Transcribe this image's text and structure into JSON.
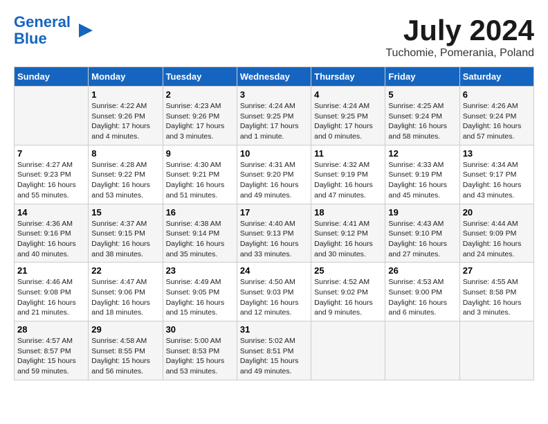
{
  "logo": {
    "line1": "General",
    "line2": "Blue"
  },
  "title": "July 2024",
  "location": "Tuchomie, Pomerania, Poland",
  "days_of_week": [
    "Sunday",
    "Monday",
    "Tuesday",
    "Wednesday",
    "Thursday",
    "Friday",
    "Saturday"
  ],
  "weeks": [
    [
      {
        "day": "",
        "info": ""
      },
      {
        "day": "1",
        "info": "Sunrise: 4:22 AM\nSunset: 9:26 PM\nDaylight: 17 hours\nand 4 minutes."
      },
      {
        "day": "2",
        "info": "Sunrise: 4:23 AM\nSunset: 9:26 PM\nDaylight: 17 hours\nand 3 minutes."
      },
      {
        "day": "3",
        "info": "Sunrise: 4:24 AM\nSunset: 9:25 PM\nDaylight: 17 hours\nand 1 minute."
      },
      {
        "day": "4",
        "info": "Sunrise: 4:24 AM\nSunset: 9:25 PM\nDaylight: 17 hours\nand 0 minutes."
      },
      {
        "day": "5",
        "info": "Sunrise: 4:25 AM\nSunset: 9:24 PM\nDaylight: 16 hours\nand 58 minutes."
      },
      {
        "day": "6",
        "info": "Sunrise: 4:26 AM\nSunset: 9:24 PM\nDaylight: 16 hours\nand 57 minutes."
      }
    ],
    [
      {
        "day": "7",
        "info": "Sunrise: 4:27 AM\nSunset: 9:23 PM\nDaylight: 16 hours\nand 55 minutes."
      },
      {
        "day": "8",
        "info": "Sunrise: 4:28 AM\nSunset: 9:22 PM\nDaylight: 16 hours\nand 53 minutes."
      },
      {
        "day": "9",
        "info": "Sunrise: 4:30 AM\nSunset: 9:21 PM\nDaylight: 16 hours\nand 51 minutes."
      },
      {
        "day": "10",
        "info": "Sunrise: 4:31 AM\nSunset: 9:20 PM\nDaylight: 16 hours\nand 49 minutes."
      },
      {
        "day": "11",
        "info": "Sunrise: 4:32 AM\nSunset: 9:19 PM\nDaylight: 16 hours\nand 47 minutes."
      },
      {
        "day": "12",
        "info": "Sunrise: 4:33 AM\nSunset: 9:19 PM\nDaylight: 16 hours\nand 45 minutes."
      },
      {
        "day": "13",
        "info": "Sunrise: 4:34 AM\nSunset: 9:17 PM\nDaylight: 16 hours\nand 43 minutes."
      }
    ],
    [
      {
        "day": "14",
        "info": "Sunrise: 4:36 AM\nSunset: 9:16 PM\nDaylight: 16 hours\nand 40 minutes."
      },
      {
        "day": "15",
        "info": "Sunrise: 4:37 AM\nSunset: 9:15 PM\nDaylight: 16 hours\nand 38 minutes."
      },
      {
        "day": "16",
        "info": "Sunrise: 4:38 AM\nSunset: 9:14 PM\nDaylight: 16 hours\nand 35 minutes."
      },
      {
        "day": "17",
        "info": "Sunrise: 4:40 AM\nSunset: 9:13 PM\nDaylight: 16 hours\nand 33 minutes."
      },
      {
        "day": "18",
        "info": "Sunrise: 4:41 AM\nSunset: 9:12 PM\nDaylight: 16 hours\nand 30 minutes."
      },
      {
        "day": "19",
        "info": "Sunrise: 4:43 AM\nSunset: 9:10 PM\nDaylight: 16 hours\nand 27 minutes."
      },
      {
        "day": "20",
        "info": "Sunrise: 4:44 AM\nSunset: 9:09 PM\nDaylight: 16 hours\nand 24 minutes."
      }
    ],
    [
      {
        "day": "21",
        "info": "Sunrise: 4:46 AM\nSunset: 9:08 PM\nDaylight: 16 hours\nand 21 minutes."
      },
      {
        "day": "22",
        "info": "Sunrise: 4:47 AM\nSunset: 9:06 PM\nDaylight: 16 hours\nand 18 minutes."
      },
      {
        "day": "23",
        "info": "Sunrise: 4:49 AM\nSunset: 9:05 PM\nDaylight: 16 hours\nand 15 minutes."
      },
      {
        "day": "24",
        "info": "Sunrise: 4:50 AM\nSunset: 9:03 PM\nDaylight: 16 hours\nand 12 minutes."
      },
      {
        "day": "25",
        "info": "Sunrise: 4:52 AM\nSunset: 9:02 PM\nDaylight: 16 hours\nand 9 minutes."
      },
      {
        "day": "26",
        "info": "Sunrise: 4:53 AM\nSunset: 9:00 PM\nDaylight: 16 hours\nand 6 minutes."
      },
      {
        "day": "27",
        "info": "Sunrise: 4:55 AM\nSunset: 8:58 PM\nDaylight: 16 hours\nand 3 minutes."
      }
    ],
    [
      {
        "day": "28",
        "info": "Sunrise: 4:57 AM\nSunset: 8:57 PM\nDaylight: 15 hours\nand 59 minutes."
      },
      {
        "day": "29",
        "info": "Sunrise: 4:58 AM\nSunset: 8:55 PM\nDaylight: 15 hours\nand 56 minutes."
      },
      {
        "day": "30",
        "info": "Sunrise: 5:00 AM\nSunset: 8:53 PM\nDaylight: 15 hours\nand 53 minutes."
      },
      {
        "day": "31",
        "info": "Sunrise: 5:02 AM\nSunset: 8:51 PM\nDaylight: 15 hours\nand 49 minutes."
      },
      {
        "day": "",
        "info": ""
      },
      {
        "day": "",
        "info": ""
      },
      {
        "day": "",
        "info": ""
      }
    ]
  ]
}
